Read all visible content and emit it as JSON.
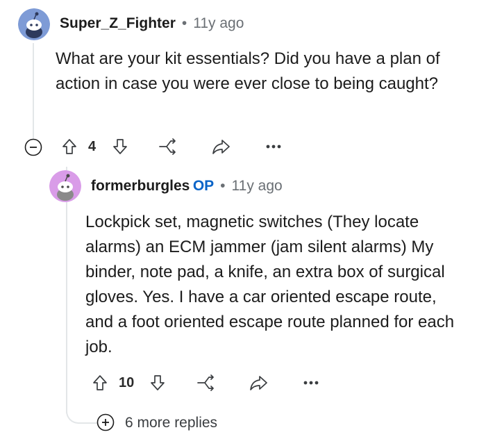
{
  "comment": {
    "username": "Super_Z_Fighter",
    "separator": "•",
    "timestamp": "11y ago",
    "avatar_color": "#7e9bd6",
    "text": "What are your kit essentials? Did you have a plan of action in case you were ever close to being caught?",
    "votes": "4",
    "collapse_icon": "minus-circle-icon"
  },
  "reply": {
    "username": "formerburgles",
    "op_badge": "OP",
    "separator": "•",
    "timestamp": "11y ago",
    "avatar_color": "#d99ce8",
    "text": "Lockpick set, magnetic switches (They locate alarms) an ECM jammer (jam silent alarms) My binder, note pad, a knife, an extra box of surgical gloves. Yes. I have a car oriented escape route, and a foot oriented escape route planned for each job.",
    "votes": "10"
  },
  "more_replies": {
    "label": "6 more replies",
    "icon": "plus-circle-icon"
  },
  "colors": {
    "op_badge": "#0a64c8",
    "meta_gray": "#6a6f74",
    "thread_line": "#e3e6e8"
  }
}
